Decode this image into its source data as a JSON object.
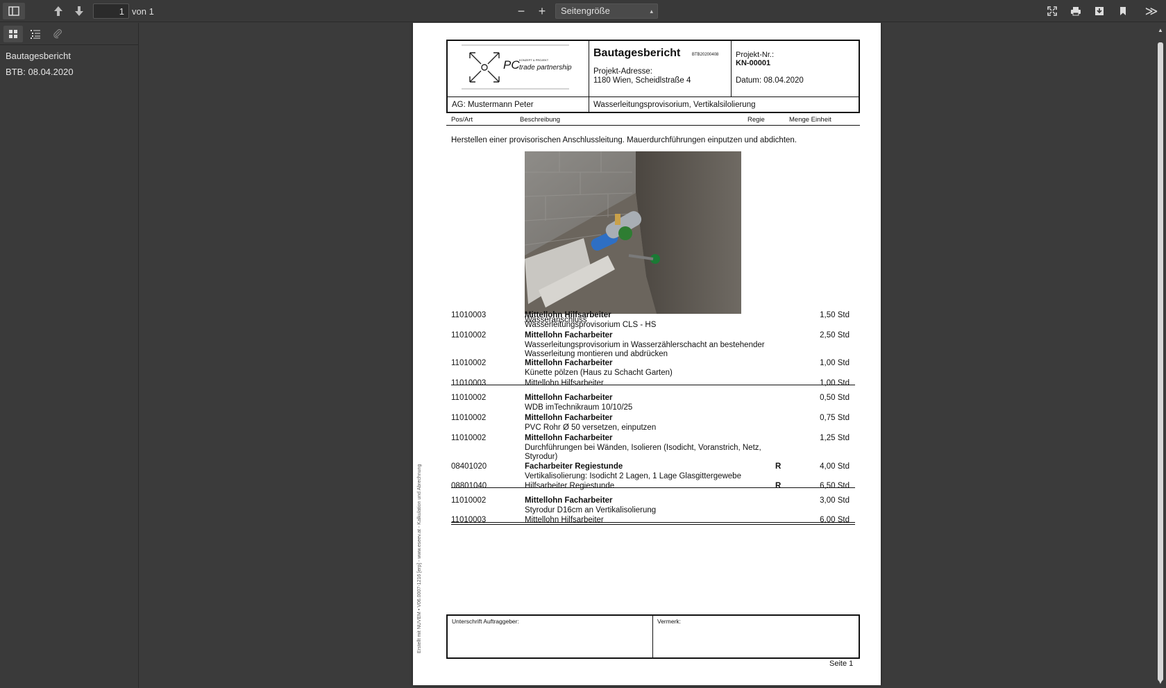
{
  "toolbar": {
    "page_number": "1",
    "page_count": "von 1",
    "zoom": "Seitengröße",
    "zoom_out": "−",
    "zoom_in": "+",
    "tools": "≫"
  },
  "sidebar": {
    "outline": [
      {
        "label": "Bautagesbericht"
      },
      {
        "label": "BTB: 08.04.2020"
      }
    ]
  },
  "document": {
    "logo_text": "PC",
    "logo_sub": "trade partnership",
    "logo_small": "KONZEPT & PROJEKT",
    "title": "Bautagesbericht",
    "code": "BTB20200408",
    "address_label": "Projekt-Adresse:",
    "address": "1180 Wien, Scheidlstraße 4",
    "project_label": "Projekt-Nr.:",
    "project_no": "KN-00001",
    "date": "Datum: 08.04.2020",
    "client": "AG: Mustermann Peter",
    "description": "Wasserleitungsprovisorium, Vertikalsilolierung",
    "columns": {
      "pos": "Pos/Art",
      "desc": "Beschreibung",
      "regie": "Regie",
      "qty": "Menge Einheit"
    },
    "intro": "Herstellen einer provisorischen Anschlussleitung. Mauerdurchführungen einputzen und abdichten.",
    "photo_caption": "Wasseranschluss",
    "rows": [
      {
        "pos": "11010003",
        "title": "Mittellohn Hilfsarbeiter",
        "text": "Wasserleitungsprovisorium CLS - HS",
        "regie": "",
        "qty": "1,50 Std"
      },
      {
        "pos": "11010002",
        "title": "Mittellohn Facharbeiter",
        "text": "Wasserleitungsprovisorium in Wasserzählerschacht an bestehender Wasserleitung montieren und abdrücken",
        "regie": "",
        "qty": "2,50 Std"
      },
      {
        "pos": "11010002",
        "title": "Mittellohn Facharbeiter",
        "text": "Künette pölzen (Haus zu Schacht Garten)",
        "regie": "",
        "qty": "1,00 Std"
      },
      {
        "pos": "11010003",
        "title": "",
        "text": "Mittellohn Hilfsarbeiter",
        "regie": "",
        "qty": "1,00 Std"
      },
      {
        "pos": "11010002",
        "title": "Mittellohn Facharbeiter",
        "text": "WDB imTechnikraum 10/10/25",
        "regie": "",
        "qty": "0,50 Std"
      },
      {
        "pos": "11010002",
        "title": "Mittellohn Facharbeiter",
        "text": "PVC Rohr Ø 50 versetzen, einputzen",
        "regie": "",
        "qty": "0,75 Std"
      },
      {
        "pos": "11010002",
        "title": "Mittellohn Facharbeiter",
        "text": "Durchführungen bei Wänden, Isolieren  (Isodicht, Voranstrich, Netz, Styrodur)",
        "regie": "",
        "qty": "1,25 Std"
      },
      {
        "pos": "08401020",
        "title": "Facharbeiter Regiestunde",
        "text": "Vertikalisolierung: Isodicht 2 Lagen, 1 Lage Glasgittergewebe",
        "regie": "R",
        "qty": "4,00 Std"
      },
      {
        "pos": "08801040",
        "title": "",
        "text": "Hilfsarbeiter Regiestunde",
        "regie": "R",
        "qty": "6,50 Std"
      },
      {
        "pos": "11010002",
        "title": "Mittellohn Facharbeiter",
        "text": "Styrodur D16cm an Vertikalisolierung",
        "regie": "",
        "qty": "3,00 Std"
      },
      {
        "pos": "11010003",
        "title": "",
        "text": "Mittellohn Hilfsarbeiter",
        "regie": "",
        "qty": "6,00 Std"
      }
    ],
    "sign_client": "Unterschrift Auftraggeber:",
    "sign_note": "Vermerk:",
    "page_label": "Seite 1",
    "side_note": "Erstellt mit NUVEM • V06.0007-1216 [erp] - www.eseev.at - Kalkulation und Abrechnung"
  }
}
